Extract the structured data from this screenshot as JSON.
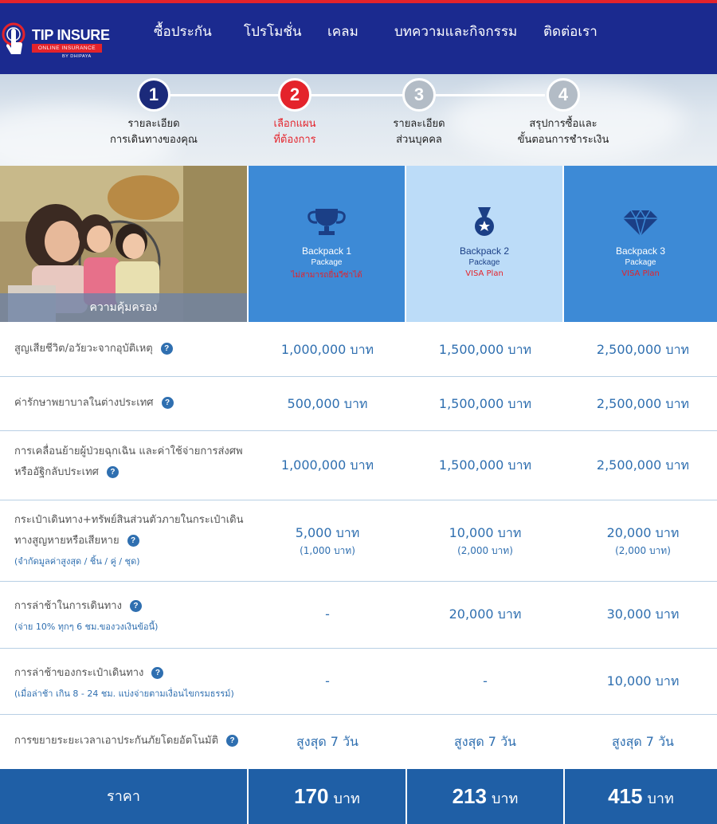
{
  "header": {
    "logo": {
      "brand": "TIP INSURE",
      "tagline": "ONLINE INSURANCE",
      "by": "BY DHIPAYA"
    },
    "nav": [
      "ซื้อประกัน",
      "โปรโมชั่น",
      "เคลม",
      "บทความและกิจกรรม",
      "ติดต่อเรา"
    ]
  },
  "steps": [
    {
      "number": "1",
      "line1": "รายละเอียด",
      "line2": "การเดินทางของคุณ",
      "status": "done",
      "color": "#1b2a7a"
    },
    {
      "number": "2",
      "line1": "เลือกแผน",
      "line2": "ที่ต้องการ",
      "status": "active",
      "color": "#e4232b"
    },
    {
      "number": "3",
      "line1": "รายละเอียด",
      "line2": "ส่วนบุคคล",
      "status": "pending",
      "color": "#b3bcc6"
    },
    {
      "number": "4",
      "line1": "สรุปการซื้อและ",
      "line2": "ขั้นตอนการชำระเงิน",
      "status": "pending",
      "color": "#b3bcc6"
    }
  ],
  "coverage_caption": "ความคุ้มครอง",
  "packages": [
    {
      "name": "Backpack 1",
      "word": "Package",
      "note": "ไม่สามารถยื่นวีซ่าได้",
      "icon": "trophy-icon",
      "bg": "#3d8ad6",
      "fg": "#ffffff",
      "icon_color": "#1b3f86"
    },
    {
      "name": "Backpack 2",
      "word": "Package",
      "note": "VISA Plan",
      "icon": "medal-icon",
      "bg": "#bcdcf8",
      "fg": "#1b3f86",
      "icon_color": "#1b3f86"
    },
    {
      "name": "Backpack 3",
      "word": "Package",
      "note": "VISA Plan",
      "icon": "diamond-icon",
      "bg": "#3d8ad6",
      "fg": "#ffffff",
      "icon_color": "#1b3f86"
    }
  ],
  "rows": [
    {
      "label": [
        "สูญเสียชีวิต/อวัยวะจากอุบัติเหตุ"
      ],
      "sub": "",
      "values": [
        "1,000,000 บาท",
        "1,500,000 บาท",
        "2,500,000 บาท"
      ],
      "subs": [
        "",
        "",
        ""
      ]
    },
    {
      "label": [
        "ค่ารักษาพยาบาลในต่างประเทศ"
      ],
      "sub": "",
      "values": [
        "500,000 บาท",
        "1,500,000 บาท",
        "2,500,000 บาท"
      ],
      "subs": [
        "",
        "",
        ""
      ]
    },
    {
      "label": [
        "การเคลื่อนย้ายผู้ป่วยฉุกเฉิน และค่าใช้จ่ายการส่งศพ",
        "หรืออัฐิกลับประเทศ"
      ],
      "sub": "",
      "values": [
        "1,000,000 บาท",
        "1,500,000 บาท",
        "2,500,000 บาท"
      ],
      "subs": [
        "",
        "",
        ""
      ]
    },
    {
      "label": [
        "กระเป๋าเดินทาง+ทรัพย์สินส่วนตัวภายในกระเป๋าเดิน",
        "ทางสูญหายหรือเสียหาย"
      ],
      "sub": "(จำกัดมูลค่าสูงสุด / ชิ้น / คู่ / ชุด)",
      "values": [
        "5,000 บาท",
        "10,000 บาท",
        "20,000 บาท"
      ],
      "subs": [
        "(1,000 บาท)",
        "(2,000 บาท)",
        "(2,000 บาท)"
      ]
    },
    {
      "label": [
        "การล่าช้าในการเดินทาง"
      ],
      "sub": "(จ่าย 10% ทุกๆ 6 ชม.ของวงเงินข้อนี้)",
      "values": [
        "-",
        "20,000 บาท",
        "30,000 บาท"
      ],
      "subs": [
        "",
        "",
        ""
      ]
    },
    {
      "label": [
        "การล่าช้าของกระเป๋าเดินทาง"
      ],
      "sub": "(เมื่อล่าช้า เกิน 8 - 24 ชม. แบ่งจ่ายตามเงื่อนไขกรมธรรม์)",
      "values": [
        "-",
        "-",
        "10,000 บาท"
      ],
      "subs": [
        "",
        "",
        ""
      ]
    },
    {
      "label": [
        "การขยายระยะเวลาเอาประกันภัยโดยอัตโนมัติ"
      ],
      "sub": "",
      "values": [
        "สูงสุด 7 วัน",
        "สูงสุด 7 วัน",
        "สูงสุด 7 วัน"
      ],
      "subs": [
        "",
        "",
        ""
      ]
    }
  ],
  "price": {
    "label": "ราคา",
    "values": [
      "170",
      "213",
      "415"
    ],
    "unit": "บาท"
  },
  "help_icon_glyph": "?",
  "colors": {
    "header_bg": "#1b2a8f",
    "accent_red": "#e4232b",
    "value_blue": "#2f6fb0",
    "price_bg": "#1f5fa6"
  }
}
